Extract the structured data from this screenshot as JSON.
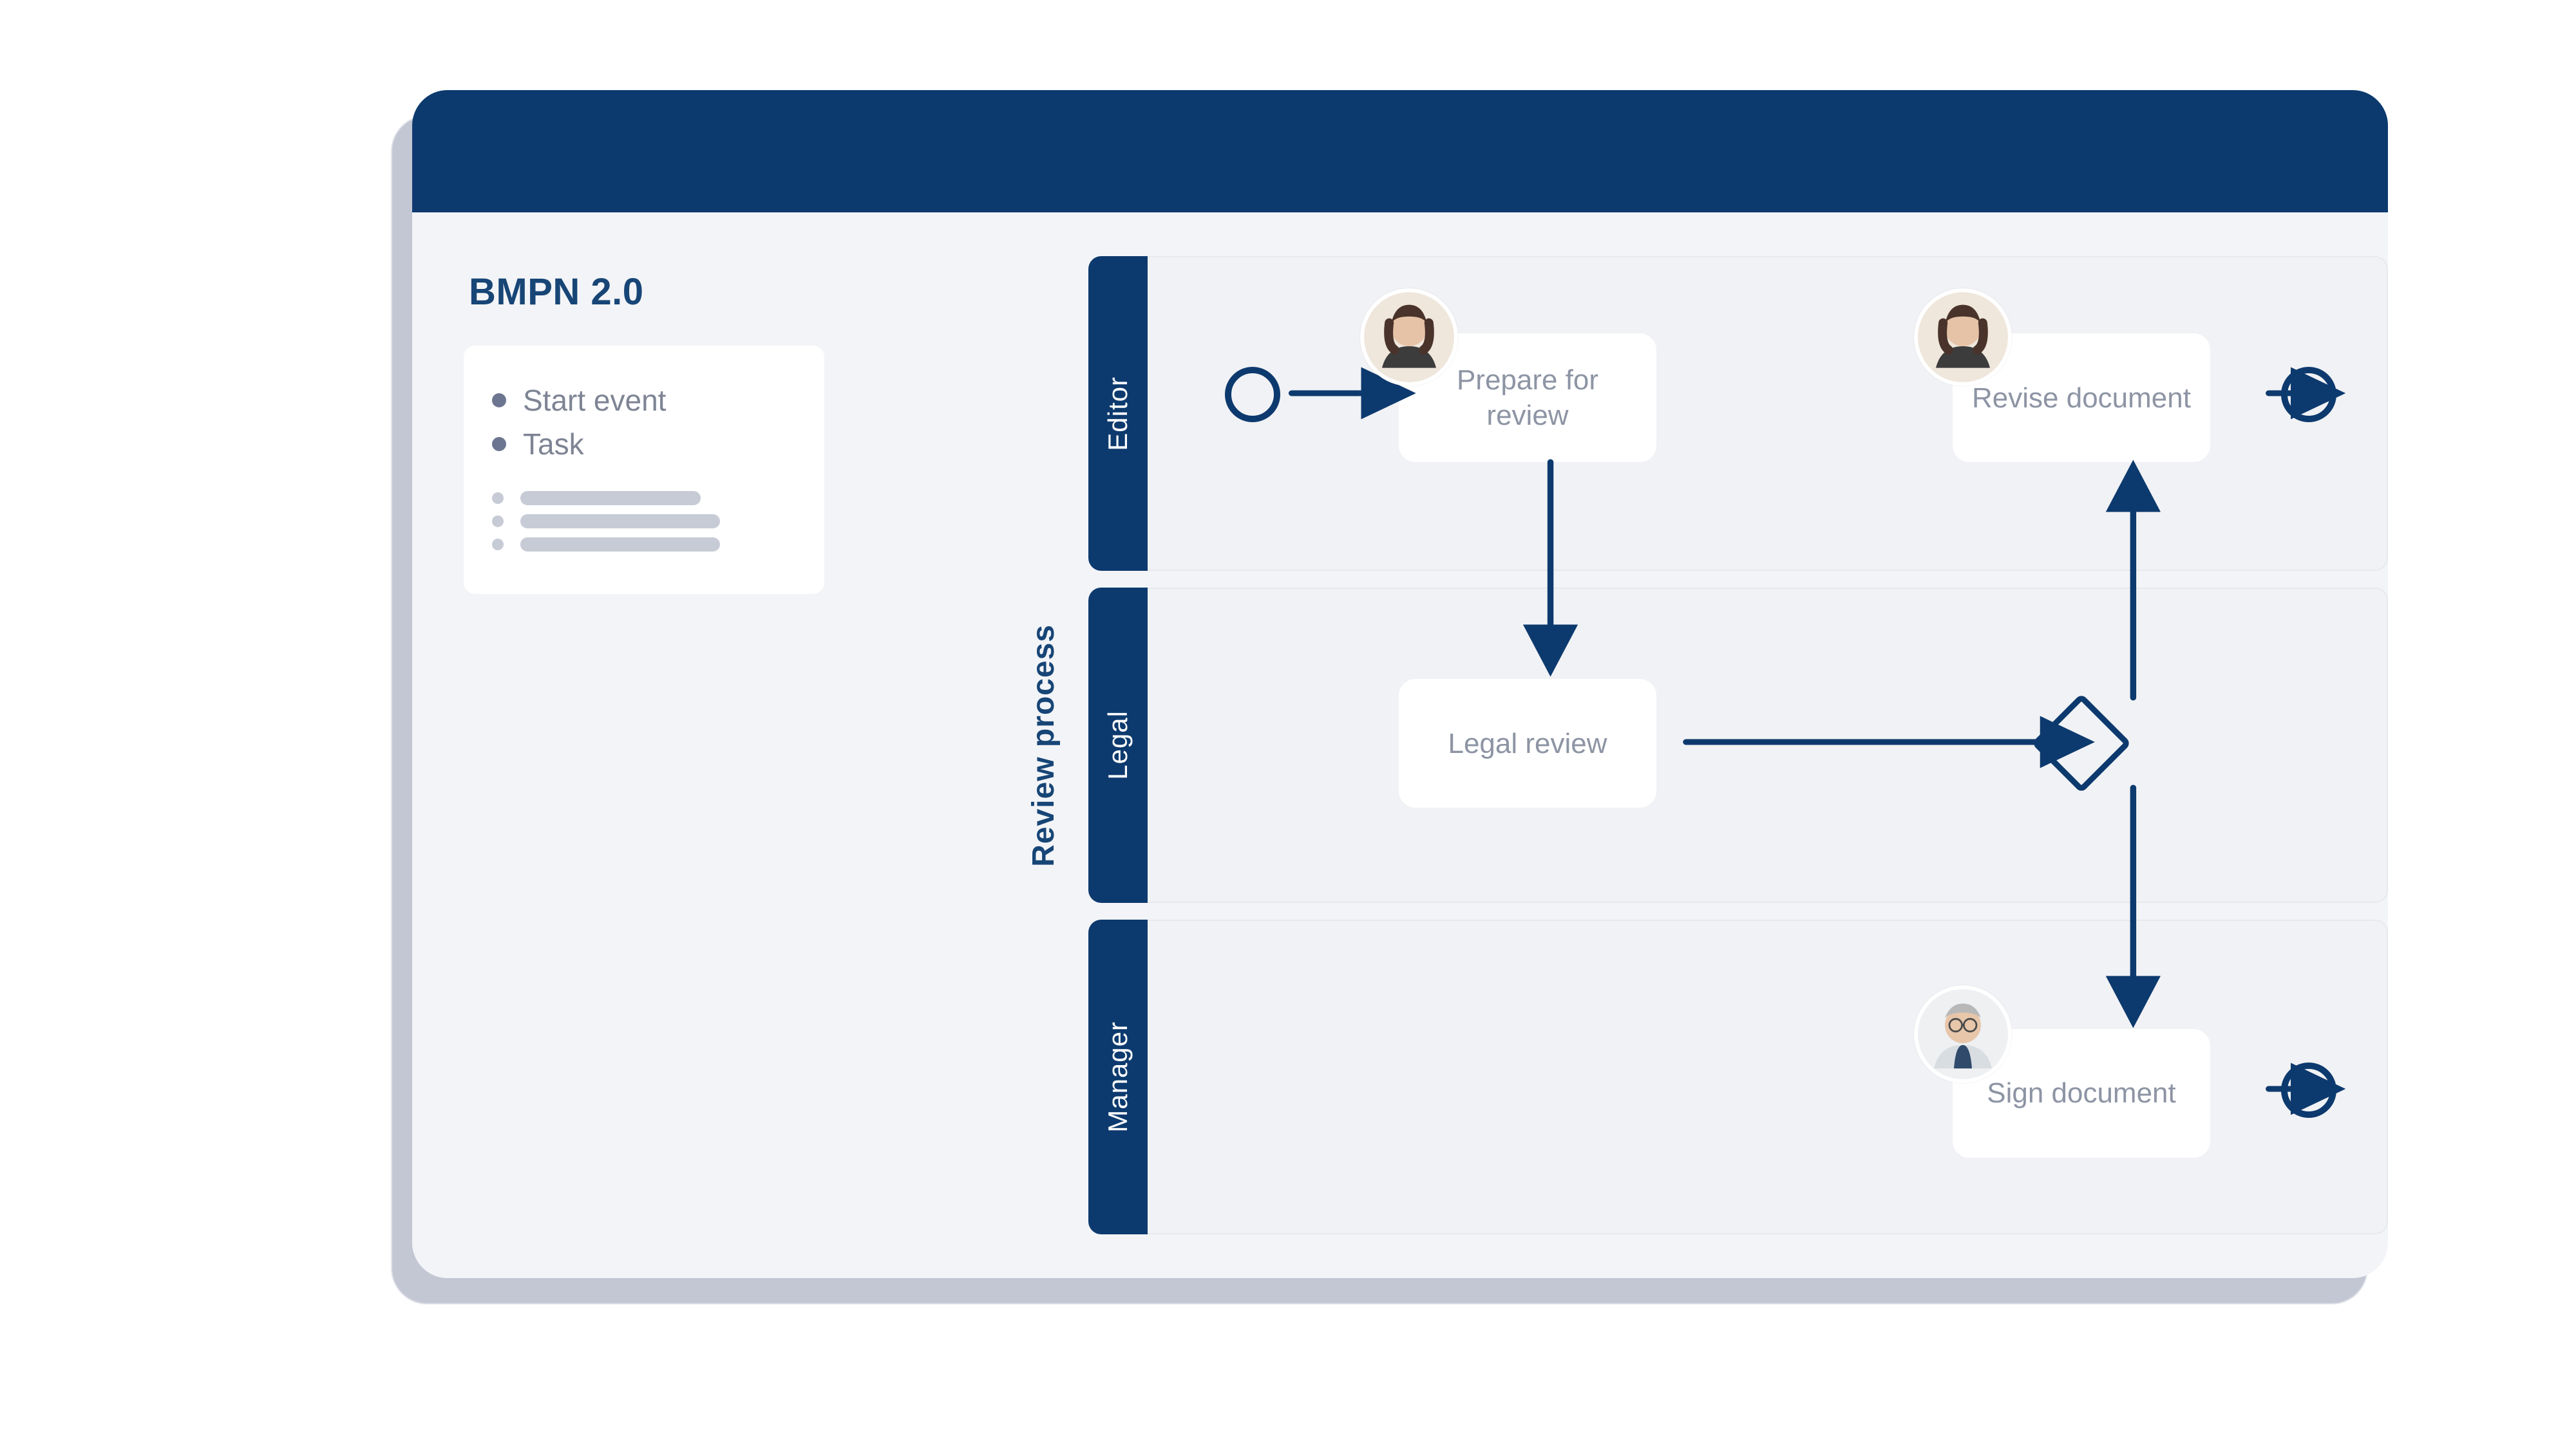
{
  "sidebar": {
    "title": "BMPN 2.0",
    "palette": {
      "items": [
        {
          "label": "Start event"
        },
        {
          "label": "Task"
        }
      ]
    }
  },
  "pool": {
    "title": "Review process",
    "lanes": [
      {
        "name": "Editor"
      },
      {
        "name": "Legal"
      },
      {
        "name": "Manager"
      }
    ]
  },
  "tasks": {
    "prepare": "Prepare for review",
    "legal": "Legal review",
    "revise": "Revise document",
    "sign": "Sign document"
  },
  "colors": {
    "navy": "#0d3a6e"
  }
}
